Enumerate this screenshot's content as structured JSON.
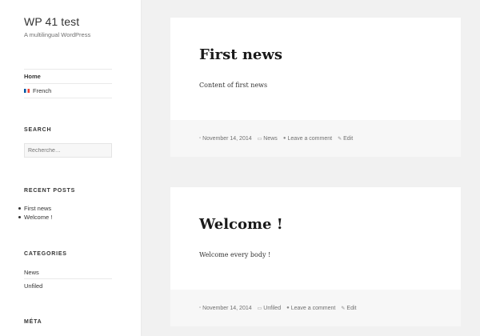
{
  "site": {
    "title": "WP 41 test",
    "description": "A multilingual WordPress"
  },
  "language_menu": {
    "items": [
      {
        "label": "Home"
      },
      {
        "label": "French"
      }
    ]
  },
  "search": {
    "heading": "SEARCH",
    "placeholder": "Recherche…"
  },
  "recent_posts": {
    "heading": "RECENT POSTS",
    "items": [
      "First news",
      "Welcome !"
    ]
  },
  "categories": {
    "heading": "CATEGORIES",
    "items": [
      "News",
      "Unfiled"
    ]
  },
  "meta": {
    "heading": "MÉTA"
  },
  "posts": [
    {
      "title": "First news",
      "content": "Content of first news",
      "date": "November 14, 2014",
      "category": "News",
      "comment": "Leave a comment",
      "edit": "Edit"
    },
    {
      "title": "Welcome !",
      "content": "Welcome every body !",
      "date": "November 14, 2014",
      "category": "Unfiled",
      "comment": "Leave a comment",
      "edit": "Edit"
    }
  ]
}
